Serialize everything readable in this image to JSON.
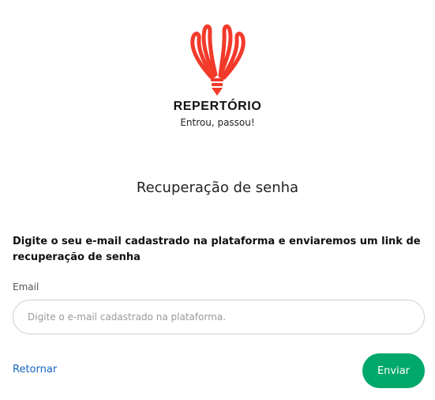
{
  "brand": {
    "name": "REPERTÓRIO",
    "tagline": "Entrou, passou!",
    "logo_icon": "lightbulb-icon",
    "accent_color": "#f23a2a"
  },
  "page": {
    "title": "Recuperação de senha",
    "instructions": "Digite o seu e-mail cadastrado na plataforma e enviaremos um link de recuperação de senha"
  },
  "form": {
    "email_label": "Email",
    "email_value": "",
    "email_placeholder": "Digite o e-mail cadastrado na plataforma.",
    "back_label": "Retornar",
    "submit_label": "Enviar",
    "submit_color": "#00a86b"
  }
}
